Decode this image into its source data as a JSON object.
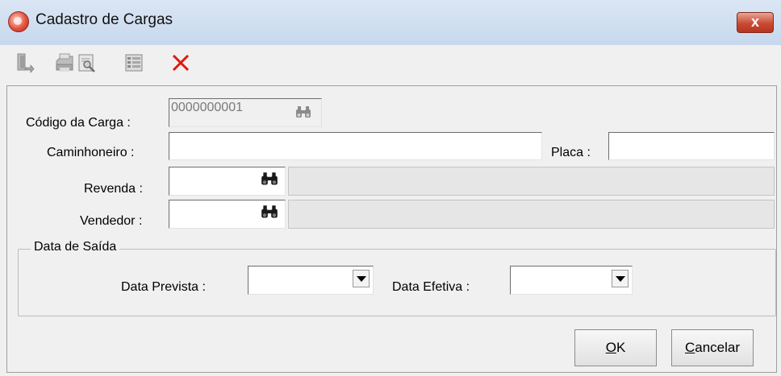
{
  "window": {
    "title": "Cadastro de Cargas",
    "close_label": "x"
  },
  "toolbar": {
    "items": [
      {
        "icon": "exit-icon"
      },
      {
        "icon": "print-icon"
      },
      {
        "icon": "preview-icon"
      },
      {
        "icon": "report-icon"
      },
      {
        "icon": "delete-icon",
        "color": "#e0180c"
      }
    ]
  },
  "form": {
    "codigo": {
      "label": "Código da Carga :",
      "value": "0000000001"
    },
    "caminhoneiro": {
      "label": "Caminhoneiro :",
      "value": ""
    },
    "placa": {
      "label": "Placa :",
      "value": ""
    },
    "revenda": {
      "label": "Revenda :",
      "value": "",
      "description": ""
    },
    "vendedor": {
      "label": "Vendedor :",
      "value": "",
      "description": ""
    }
  },
  "data_saida": {
    "legend": "Data de Saída",
    "prevista": {
      "label": "Data Prevista :",
      "value": ""
    },
    "efetiva": {
      "label": "Data Efetiva :",
      "value": ""
    }
  },
  "buttons": {
    "ok": {
      "mnemonic": "O",
      "rest": "K"
    },
    "cancelar": {
      "mnemonic": "C",
      "rest": "ancelar"
    }
  }
}
